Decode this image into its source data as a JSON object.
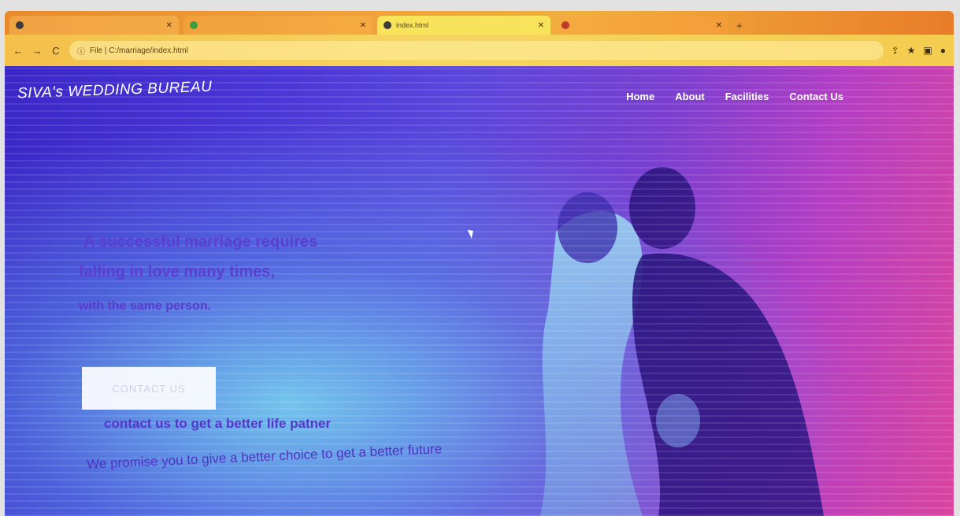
{
  "browser": {
    "tabs": [
      {
        "title": "",
        "favicon": "tab-icon"
      },
      {
        "title": "",
        "favicon": "whatsapp-icon"
      },
      {
        "title": "index.html",
        "favicon": "globe-icon"
      },
      {
        "title": "",
        "favicon": "chrome-icon"
      }
    ],
    "new_tab": "+",
    "back": "←",
    "forward": "→",
    "reload": "C",
    "address": "File | C:/marriage/index.html",
    "toolbar_icons": [
      "share-icon",
      "star-icon",
      "extensions-icon",
      "profile-icon"
    ]
  },
  "site": {
    "brand": "SIVA's WEDDING BUREAU",
    "nav": [
      {
        "label": "Home"
      },
      {
        "label": "About"
      },
      {
        "label": "Facilities"
      },
      {
        "label": "Contact Us"
      }
    ],
    "hero": {
      "eyebrow": "",
      "line1": "A successful marriage requires",
      "line2": "falling in love many times,",
      "line3": "with the same person."
    },
    "cta_label": "CONTACT US",
    "tagline": "contact us to get a better life patner",
    "promise": "We promise you to give a better choice to get a better future"
  },
  "colors": {
    "tabbar": "#e98a2c",
    "addressbar": "#f6d660",
    "hero_start": "#3b26c6",
    "hero_end": "#d9459f",
    "text_white": "#ffffff",
    "text_purple": "#5b3fd0"
  }
}
